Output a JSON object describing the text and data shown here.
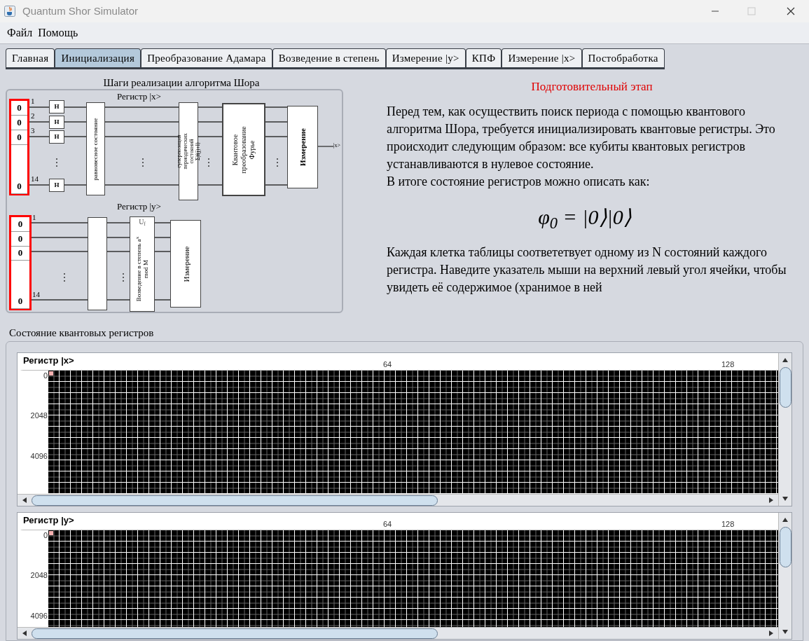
{
  "window": {
    "title": "Quantum Shor Simulator",
    "maximize_disabled": true
  },
  "menu": [
    "Файл",
    "Помощь"
  ],
  "tabs": [
    {
      "label": "Главная",
      "selected": false
    },
    {
      "label": "Инициализация",
      "selected": true
    },
    {
      "label": "Преобразование Адамара",
      "selected": false
    },
    {
      "label": "Возведение в степень",
      "selected": false
    },
    {
      "label": "Измерение |y>",
      "selected": false
    },
    {
      "label": "КПФ",
      "selected": false
    },
    {
      "label": "Измерение |x>",
      "selected": false
    },
    {
      "label": "Постобработка",
      "selected": false
    }
  ],
  "diagram": {
    "title": "Шаги реализации алгоритма Шора",
    "register_x": {
      "label": "Регистр |x>",
      "qubits": [
        "0",
        "0",
        "0",
        "0"
      ],
      "line_numbers": [
        "1",
        "2",
        "3",
        "14"
      ],
      "gates": [
        "H",
        "H",
        "H",
        "H"
      ],
      "blocks": [
        "равновесное состояние",
        "суперпозиция периодических состояний Σ|f(j)+l⟩",
        "Квантовое преобразование Фурье",
        "Измерение"
      ],
      "output": "|x>"
    },
    "register_y": {
      "label": "Регистр |y>",
      "qubits": [
        "0",
        "0",
        "0",
        "0"
      ],
      "line_numbers": [
        "1",
        "14"
      ],
      "operator": "U$_{f}$",
      "blocks": [
        "Возведение в степень a$^{x}$ mod M",
        "Измерение"
      ]
    }
  },
  "info": {
    "heading": "Подготовительный этап",
    "paragraphs": [
      "Перед тем, как осуществить поиск периода с помощью квантового алгоритма Шора, требуется инициализировать квантовые регистры. Это происходит следующим образом: все кубиты квантовых регистров устанавливаются в нулевое состояние.",
      "В итоге состояние регистров можно описать как:"
    ],
    "formula": "φ$_{0}$ = |0⟩|0⟩",
    "paragraphs_after": [
      "Каждая клетка таблицы соответетвует одному из N состояний каждого регистра. Наведите указатель мыши на верхний левый угол ячейки, чтобы увидеть её содержимое (хранимое в ней"
    ]
  },
  "registers_section": {
    "title": "Состояние квантовых регистров",
    "registers": [
      {
        "title": "Регистр |x>",
        "column_ticks": [
          "64",
          "128"
        ],
        "row_ticks": [
          "0",
          "2048",
          "4096"
        ],
        "first_cell_marked": true
      },
      {
        "title": "Регистр |y>",
        "column_ticks": [
          "64",
          "128"
        ],
        "row_ticks": [
          "0",
          "2048",
          "4096"
        ],
        "first_cell_marked": true
      }
    ]
  }
}
